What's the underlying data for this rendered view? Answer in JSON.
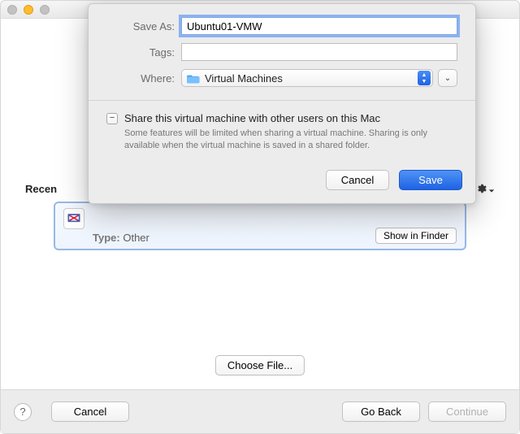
{
  "sheet": {
    "save_as_label": "Save As:",
    "save_as_value": "Ubuntu01-VMW",
    "tags_label": "Tags:",
    "tags_value": "",
    "where_label": "Where:",
    "where_value": "Virtual Machines",
    "share_checkbox_state": "mixed",
    "share_label": "Share this virtual machine with other users on this Mac",
    "share_desc": "Some features will be limited when sharing a virtual machine. Sharing is only available when the virtual machine is saved in a shared folder.",
    "cancel_label": "Cancel",
    "save_label": "Save"
  },
  "base": {
    "recent_label_prefix": "Recen",
    "item_type_label": "Type:",
    "item_type_value": "Other",
    "show_in_finder_label": "Show in Finder",
    "choose_file_label": "Choose File...",
    "help_label": "?",
    "cancel_label": "Cancel",
    "go_back_label": "Go Back",
    "continue_label": "Continue"
  },
  "icons": {
    "gear": "gear-icon",
    "chevron_down": "chevron-down-icon",
    "folder": "folder-icon",
    "vm": "vm-icon"
  }
}
